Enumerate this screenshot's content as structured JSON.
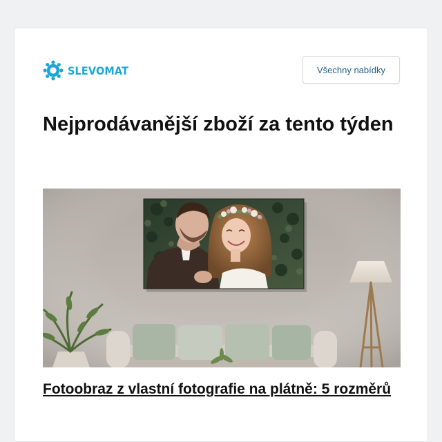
{
  "brand": {
    "name": "SLEVOMAT",
    "color": "#1ba6d6",
    "icon": "gear-cog-icon"
  },
  "header": {
    "all_offers_label": "Všechny nabídky"
  },
  "headline": "Nejprodávanější zboží za tento týden",
  "product": {
    "image": "canvas-print-photo",
    "title": "Fotoobraz z vlastní fotografie na plátně: 5 rozměrů"
  },
  "colors": {
    "page_background": "#f0f1f2",
    "card_background": "#ffffff",
    "button_text": "#1f5f8a",
    "text": "#111111"
  }
}
